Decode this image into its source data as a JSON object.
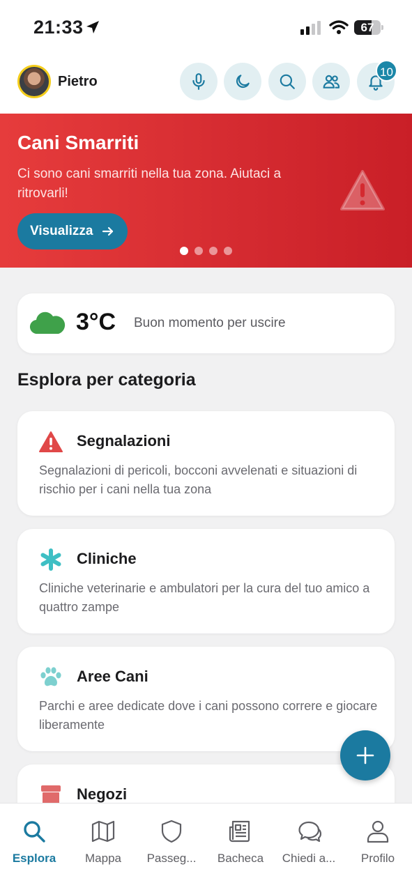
{
  "status_bar": {
    "time": "21:33",
    "battery": "67",
    "battery_level": 0.67,
    "icons": [
      "location-arrow-icon",
      "signal-icon",
      "wifi-icon",
      "battery-icon"
    ]
  },
  "header": {
    "user_name": "Pietro",
    "buttons": [
      "microphone-icon",
      "moon-icon",
      "search-icon",
      "people-icon",
      "bell-icon"
    ],
    "notification_count": "10",
    "accent_color": "#1b87a8"
  },
  "banner": {
    "title": "Cani Smarriti",
    "text": "Ci sono cani smarriti nella tua zona. Aiutaci a ritrovarli!",
    "button_label": "Visualizza",
    "page_count": 4,
    "active_page": 1,
    "color": "#d42a30"
  },
  "weather": {
    "temperature": "3°C",
    "message": "Buon momento per uscire",
    "icon": "cloud-icon"
  },
  "section_title": "Esplora per categoria",
  "categories": [
    {
      "title": "Segnalazioni",
      "description": "Segnalazioni di pericoli, bocconi avvelenati e situazioni di rischio per i cani nella tua zona",
      "icon": "warning-icon"
    },
    {
      "title": "Cliniche",
      "description": "Cliniche veterinarie e ambulatori per la cura del tuo amico a quattro zampe",
      "icon": "asterisk-icon"
    },
    {
      "title": "Aree Cani",
      "description": "Parchi e aree dedicate dove i cani possono correre e giocare liberamente",
      "icon": "paw-icon"
    },
    {
      "title": "Negozi",
      "description": "",
      "icon": "shop-icon"
    }
  ],
  "tabs": [
    {
      "label": "Esplora",
      "icon": "search-icon",
      "active": true
    },
    {
      "label": "Mappa",
      "icon": "map-icon",
      "active": false
    },
    {
      "label": "Passeg...",
      "icon": "shield-icon",
      "active": false
    },
    {
      "label": "Bacheca",
      "icon": "newspaper-icon",
      "active": false
    },
    {
      "label": "Chiedi a...",
      "icon": "chat-icon",
      "active": false
    },
    {
      "label": "Profilo",
      "icon": "person-icon",
      "active": false
    }
  ]
}
